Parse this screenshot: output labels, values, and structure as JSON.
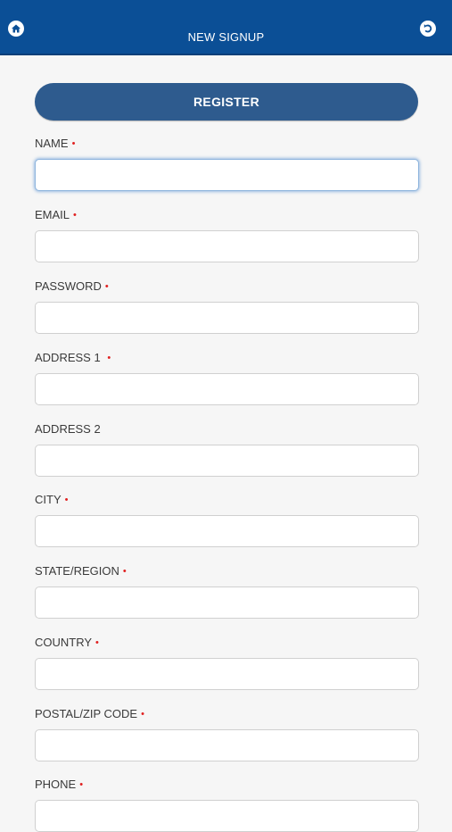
{
  "header": {
    "title": "NEW SIGNUP",
    "home_icon": "home-icon",
    "back_icon": "back-icon",
    "bg_color": "#0b4f96"
  },
  "register_label": "REGISTER",
  "required_marker": "•",
  "fields": [
    {
      "label": "NAME",
      "required": true,
      "value": "",
      "focused": true
    },
    {
      "label": "EMAIL",
      "required": true,
      "value": ""
    },
    {
      "label": "PASSWORD",
      "required": true,
      "value": ""
    },
    {
      "label": "ADDRESS 1 ",
      "required": true,
      "value": ""
    },
    {
      "label": "ADDRESS 2",
      "required": false,
      "value": ""
    },
    {
      "label": "CITY",
      "required": true,
      "value": ""
    },
    {
      "label": "STATE/REGION",
      "required": true,
      "value": ""
    },
    {
      "label": "COUNTRY",
      "required": true,
      "value": ""
    },
    {
      "label": "POSTAL/ZIP CODE",
      "required": true,
      "value": ""
    },
    {
      "label": "PHONE",
      "required": true,
      "value": ""
    }
  ]
}
